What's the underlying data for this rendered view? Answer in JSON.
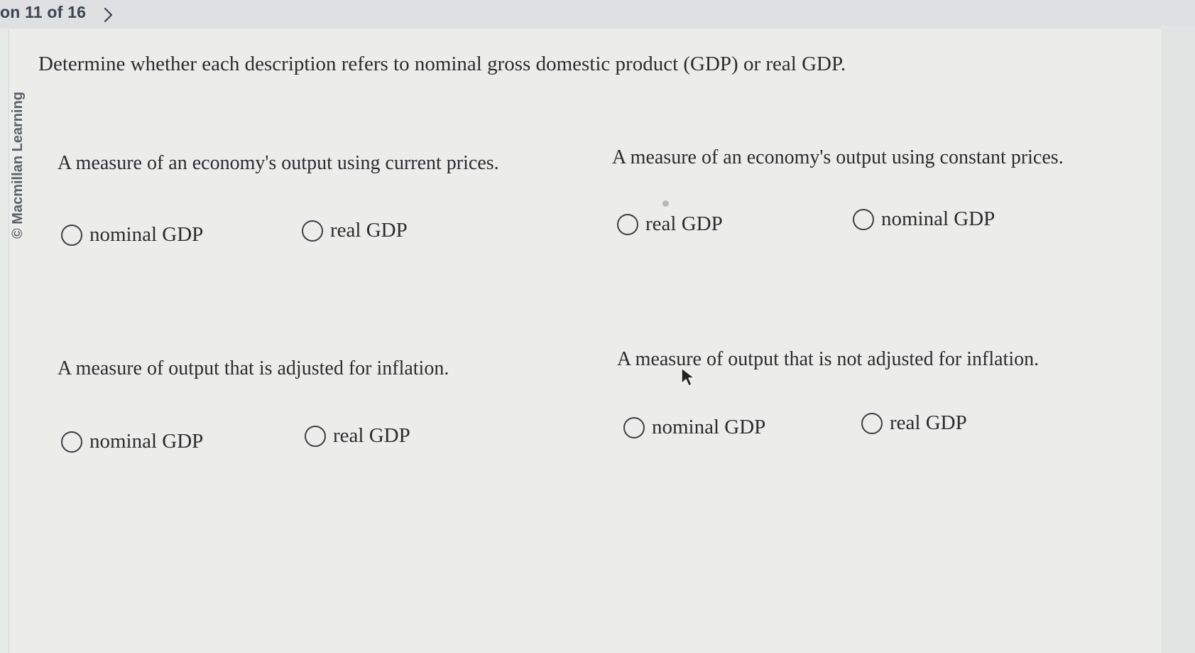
{
  "header": {
    "question_counter": "on 11 of 16",
    "next_icon": "chevron-right-icon"
  },
  "sidebar": {
    "copyright": "© Macmillan Learning"
  },
  "main": {
    "instruction": "Determine whether each description refers to nominal gross domestic product (GDP) or real GDP.",
    "items": [
      {
        "description": "A measure of an economy's output using current prices.",
        "options": [
          "nominal GDP",
          "real GDP"
        ]
      },
      {
        "description": "A measure of an economy's output using constant prices.",
        "options": [
          "real GDP",
          "nominal GDP"
        ]
      },
      {
        "description": "A measure of output that is adjusted for inflation.",
        "options": [
          "nominal GDP",
          "real GDP"
        ]
      },
      {
        "description": "A measure of output that is not adjusted for inflation.",
        "options": [
          "nominal GDP",
          "real GDP"
        ]
      }
    ]
  }
}
